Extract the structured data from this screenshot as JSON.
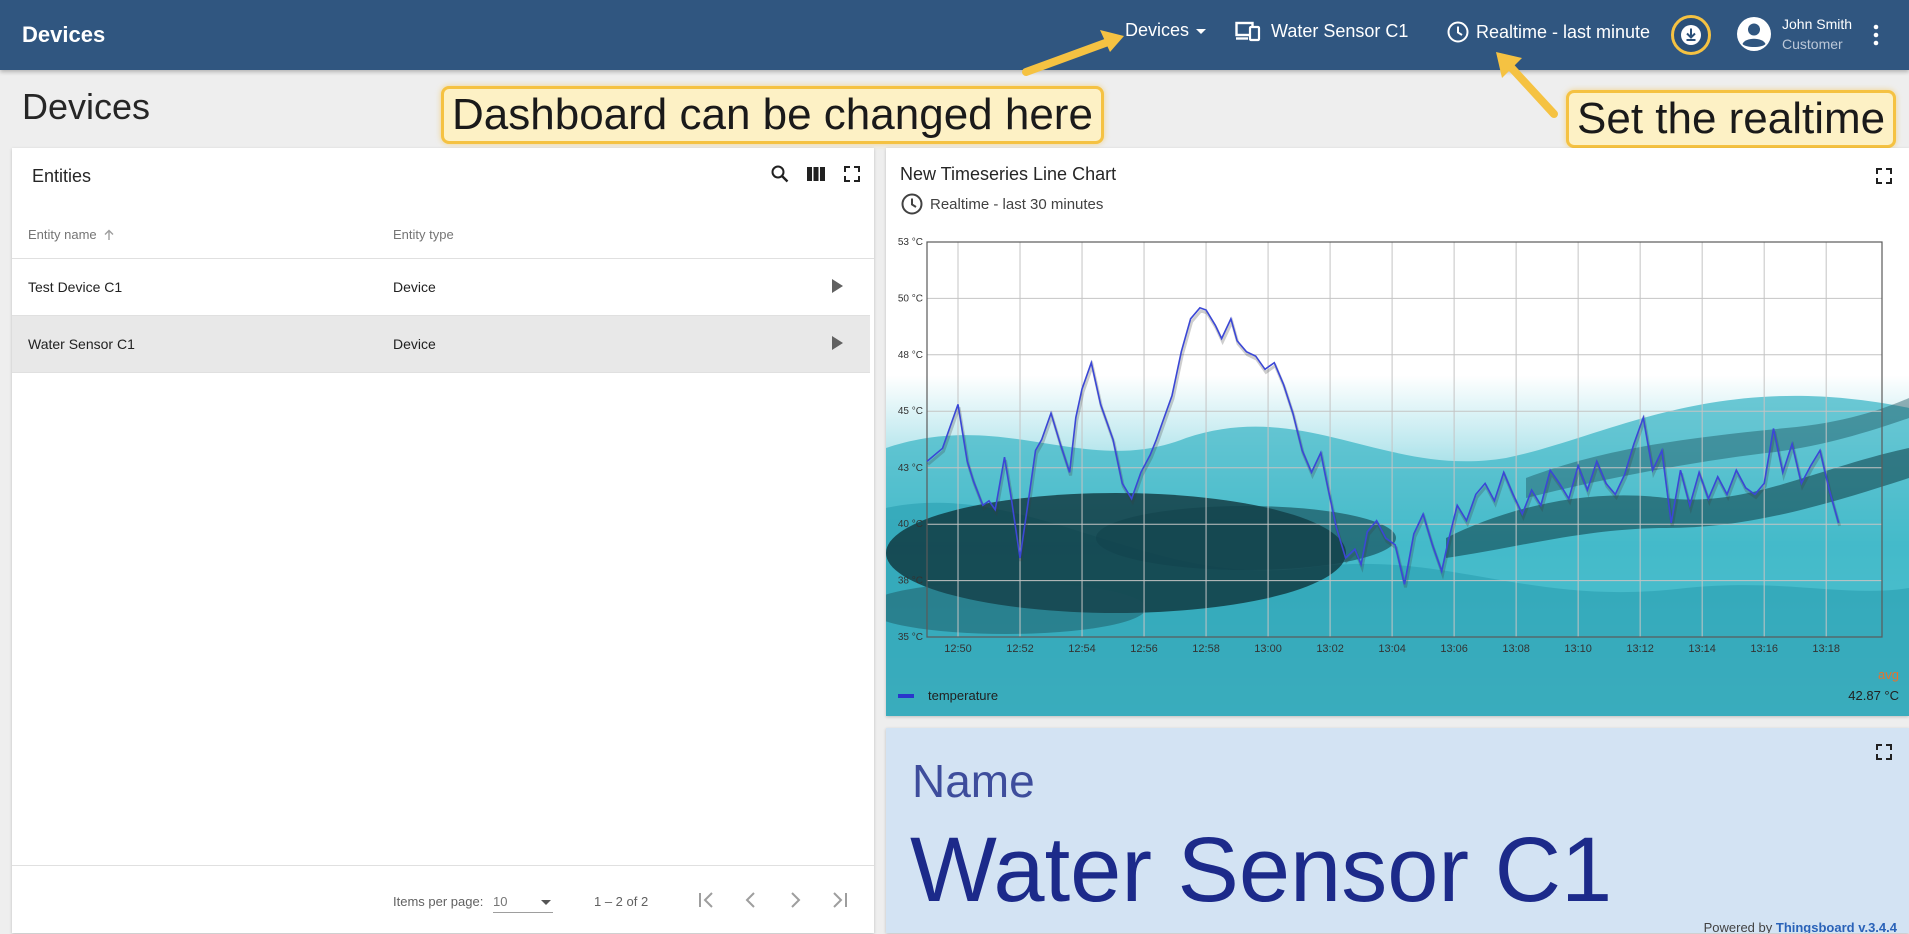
{
  "topbar": {
    "title": "Devices",
    "dashboard_label": "Devices",
    "entity_label": "Water Sensor C1",
    "timewindow_label": "Realtime - last minute",
    "user_name": "John Smith",
    "user_role": "Customer"
  },
  "page": {
    "heading": "Devices"
  },
  "callouts": {
    "dashboard": "Dashboard can be changed here",
    "realtime": "Set the realtime"
  },
  "entities": {
    "title": "Entities",
    "columns": [
      "Entity name",
      "Entity type"
    ],
    "rows": [
      {
        "name": "Test Device C1",
        "type": "Device"
      },
      {
        "name": "Water Sensor C1",
        "type": "Device"
      }
    ],
    "items_per_page_label": "Items per page:",
    "items_per_page_value": "10",
    "range_label": "1 – 2 of 2"
  },
  "chart": {
    "title": "New Timeseries Line Chart",
    "timewindow": "Realtime - last 30 minutes",
    "legend_avg_label": "avg",
    "legend_series": "temperature",
    "legend_avg_value": "42.87 °C"
  },
  "chart_data": {
    "type": "line",
    "title": "New Timeseries Line Chart",
    "xlabel": "",
    "ylabel": "",
    "grid": true,
    "legend": "bottom",
    "ylim": [
      35,
      53
    ],
    "yticks": [
      "53 °C",
      "50 °C",
      "48 °C",
      "45 °C",
      "43 °C",
      "40 °C",
      "38 °C",
      "35 °C"
    ],
    "ytick_values": [
      53,
      50.43,
      47.86,
      45.29,
      42.71,
      40.14,
      37.57,
      35
    ],
    "xticks": [
      "12:50",
      "12:52",
      "12:54",
      "12:56",
      "12:58",
      "13:00",
      "13:02",
      "13:04",
      "13:06",
      "13:08",
      "13:10",
      "13:12",
      "13:14",
      "13:16",
      "13:18"
    ],
    "xlim_minutes": [
      0,
      30.8
    ],
    "x_minutes": [
      0,
      0.5,
      1,
      1.3,
      1.5,
      1.8,
      2,
      2.2,
      2.5,
      2.7,
      3,
      3.3,
      3.5,
      3.7,
      4,
      4.3,
      4.6,
      4.8,
      5,
      5.3,
      5.6,
      6,
      6.3,
      6.6,
      6.9,
      7.2,
      7.4,
      7.6,
      7.9,
      8.2,
      8.5,
      8.8,
      9,
      9.3,
      9.5,
      9.8,
      10,
      10.3,
      10.6,
      10.9,
      11.2,
      11.5,
      11.8,
      12.1,
      12.4,
      12.7,
      12.9,
      13.2,
      13.5,
      13.8,
      14,
      14.2,
      14.5,
      14.8,
      15.1,
      15.4,
      15.7,
      16,
      16.3,
      16.6,
      16.8,
      17.1,
      17.4,
      17.7,
      18,
      18.3,
      18.6,
      18.9,
      19.2,
      19.5,
      19.8,
      20.1,
      20.4,
      20.7,
      21,
      21.3,
      21.6,
      21.9,
      22.2,
      22.5,
      22.8,
      23.1,
      23.4,
      23.7,
      24,
      24.3,
      24.6,
      24.9,
      25.2,
      25.5,
      25.8,
      26.1,
      26.4,
      26.7,
      27,
      27.3,
      27.6,
      27.9,
      28.2,
      28.5,
      28.8,
      29.1,
      29.4,
      29.7,
      30,
      30.3,
      30.6,
      30.8
    ],
    "series": [
      {
        "name": "temperature",
        "color": "#3b47d6",
        "values": [
          43,
          43.6,
          45.6,
          43,
          42.1,
          41,
          41.2,
          40.8,
          43.2,
          41.5,
          38.6,
          41.5,
          43.5,
          44,
          45.2,
          43.8,
          42.5,
          45,
          46.3,
          47.5,
          45.6,
          44,
          42,
          41.3,
          42.5,
          43.3,
          44,
          44.8,
          46,
          48,
          49.5,
          50,
          49.9,
          49.2,
          48.6,
          49.5,
          48.5,
          48,
          47.8,
          47.2,
          47.5,
          46.5,
          45.2,
          43.5,
          42.5,
          43.4,
          42,
          40,
          38.6,
          39,
          38.3,
          39.8,
          40.3,
          39.5,
          39.2,
          37.4,
          39.7,
          40.6,
          39.2,
          38,
          39.3,
          41,
          40.3,
          41.5,
          42,
          41.2,
          42.5,
          41.5,
          40.6,
          41.7,
          41,
          42.6,
          42,
          41.3,
          42.8,
          41.7,
          43,
          42,
          41.5,
          42.4,
          43.8,
          45,
          42.6,
          43.5,
          40.2,
          42.6,
          41,
          42.5,
          41.3,
          42.3,
          41.5,
          42.6,
          41.8,
          41.5,
          42,
          44.5,
          42.5,
          43.8,
          42,
          42.8,
          43.5,
          41.7,
          40.2
        ]
      }
    ]
  },
  "name_card": {
    "label": "Name",
    "value": "Water Sensor C1",
    "powered_prefix": "Powered by",
    "powered_link": "Thingsboard v.3.4.4"
  },
  "colors": {
    "topbar": "#305680",
    "callout_fill": "#fdf1c5",
    "callout_border": "#f5c242",
    "series": "#3b47d6",
    "name_card_bg": "#d3e3f3"
  },
  "icons": [
    "devices-icon",
    "clock-icon",
    "download-icon",
    "account-circle-icon",
    "more-vert-icon",
    "search-icon",
    "columns-icon",
    "fullscreen-icon",
    "arrow-up-icon",
    "play-icon",
    "first-page-icon",
    "prev-page-icon",
    "next-page-icon",
    "last-page-icon"
  ]
}
